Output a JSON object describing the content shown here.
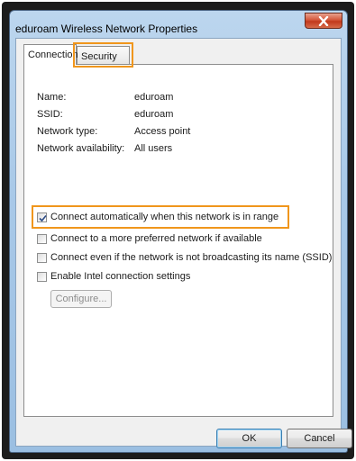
{
  "window": {
    "title": "eduroam Wireless Network Properties"
  },
  "tabs": [
    {
      "label": "Connection",
      "active": true
    },
    {
      "label": "Security",
      "active": false
    }
  ],
  "info": [
    {
      "label": "Name:",
      "value": "eduroam"
    },
    {
      "label": "SSID:",
      "value": "eduroam"
    },
    {
      "label": "Network type:",
      "value": "Access point"
    },
    {
      "label": "Network availability:",
      "value": "All users"
    }
  ],
  "options": [
    {
      "label": "Connect automatically when this network is in range",
      "checked": true
    },
    {
      "label": "Connect to a more preferred network if available",
      "checked": false
    },
    {
      "label": "Connect even if the network is not broadcasting its name (SSID)",
      "checked": false
    },
    {
      "label": "Enable Intel connection settings",
      "checked": false
    }
  ],
  "configure_button": {
    "label": "Configure...",
    "enabled": false
  },
  "buttons": {
    "ok": "OK",
    "cancel": "Cancel"
  },
  "colors": {
    "highlight": "#f0961c",
    "titlebar": "#a9c9e8",
    "close": "#c1391c"
  },
  "icons": {
    "close": "close-icon",
    "check": "check-icon"
  }
}
